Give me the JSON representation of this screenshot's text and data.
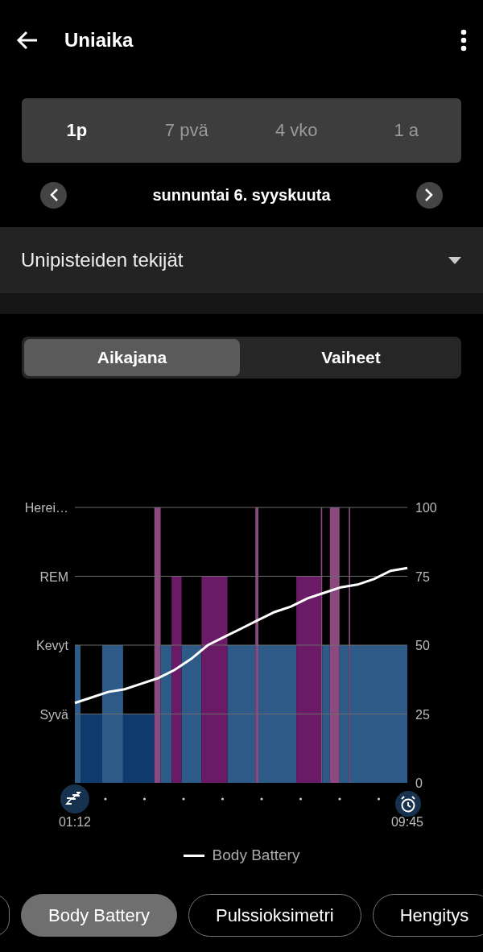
{
  "header": {
    "title": "Uniaika"
  },
  "range_tabs": [
    {
      "label": "1p",
      "selected": true
    },
    {
      "label": "7 pvä",
      "selected": false
    },
    {
      "label": "4 vko",
      "selected": false
    },
    {
      "label": "1 a",
      "selected": false
    }
  ],
  "date_nav": {
    "label": "sunnuntai 6. syyskuuta"
  },
  "section": {
    "title": "Unipisteiden tekijät",
    "expanded": false
  },
  "view_tabs": [
    {
      "label": "Aikajana",
      "selected": true
    },
    {
      "label": "Vaiheet",
      "selected": false
    }
  ],
  "chart": {
    "stage_labels": [
      "Herei…",
      "REM",
      "Kevyt",
      "Syvä"
    ],
    "chart_data": {
      "type": "line",
      "ylim": [
        0,
        100
      ],
      "grid": true,
      "yticks": [
        0,
        25,
        50,
        75,
        100
      ],
      "categories": [
        "01:12",
        null,
        null,
        null,
        null,
        null,
        null,
        null,
        null,
        null,
        null,
        null,
        null,
        null,
        null,
        null,
        null,
        null,
        null,
        null,
        "09:45"
      ],
      "series": [
        {
          "name": "Body Battery",
          "color": "#ffffff",
          "values": [
            29,
            31,
            33,
            34,
            36,
            38,
            41,
            45,
            50,
            53,
            56,
            59,
            62,
            64,
            67,
            69,
            71,
            72,
            74,
            77,
            78
          ]
        }
      ]
    }
  },
  "chips": [
    {
      "label": "Body Battery",
      "selected": true
    },
    {
      "label": "Pulssioksimetri",
      "selected": false
    },
    {
      "label": "Hengitys",
      "selected": false
    }
  ]
}
